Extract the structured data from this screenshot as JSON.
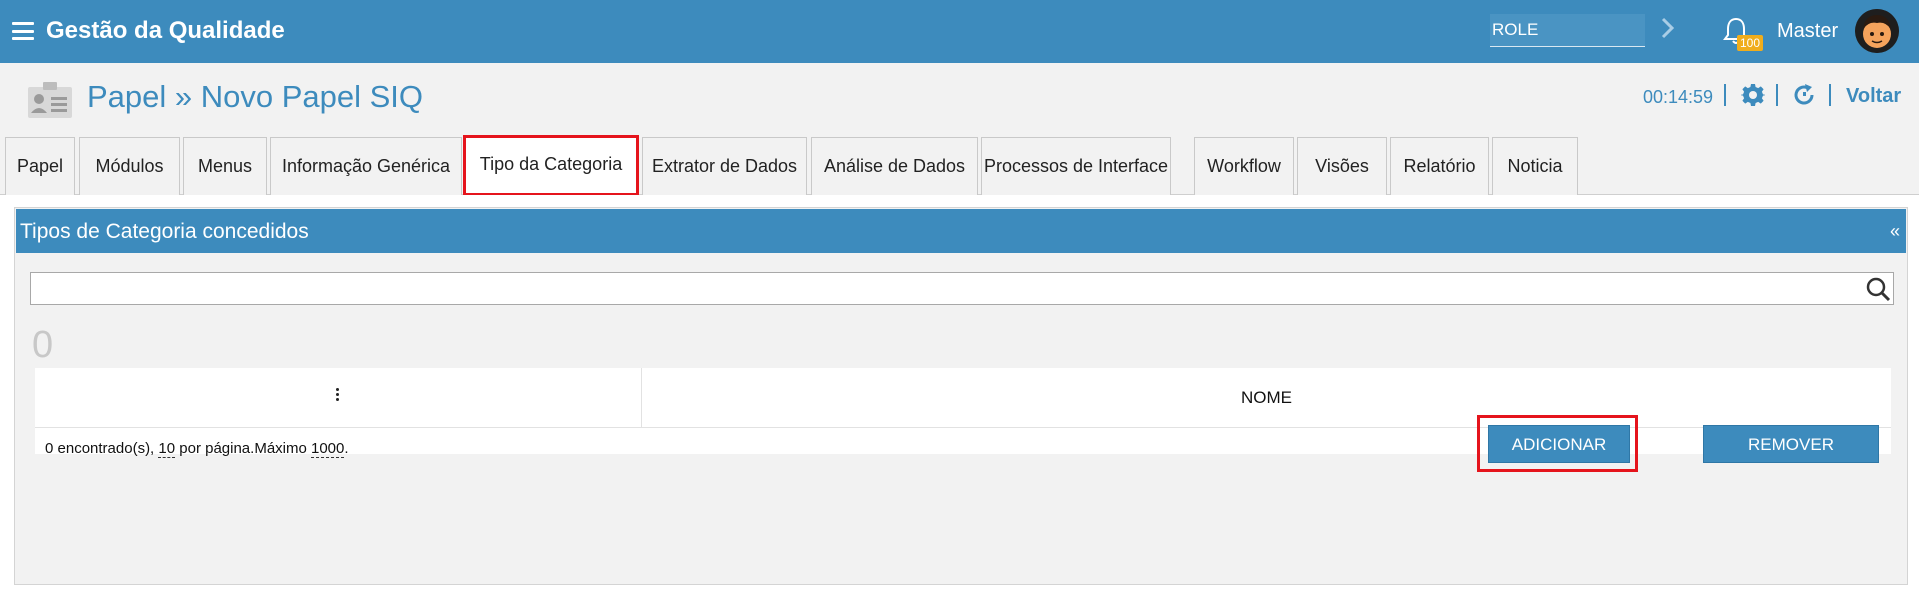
{
  "header": {
    "app_title": "Gestão da Qualidade",
    "role_value": "ROLE",
    "notification_count": "100",
    "user_name": "Master"
  },
  "page": {
    "title": "Papel » Novo Papel SIQ",
    "timer": "00:14:59",
    "back_label": "Voltar"
  },
  "tabs": [
    {
      "label": "Papel"
    },
    {
      "label": "Módulos"
    },
    {
      "label": "Menus"
    },
    {
      "label": "Informação Genérica"
    },
    {
      "label": "Tipo da Categoria",
      "active": true
    },
    {
      "label": "Extrator de Dados"
    },
    {
      "label": "Análise de Dados"
    },
    {
      "label": "Processos de Interface"
    },
    {
      "label": "Workflow"
    },
    {
      "label": "Visões"
    },
    {
      "label": "Relatório"
    },
    {
      "label": "Noticia"
    }
  ],
  "panel": {
    "title": "Tipos de Categoria concedidos",
    "collapse_icon": "«",
    "search_value": "",
    "count": "0",
    "table": {
      "columns": [
        "NOME"
      ]
    },
    "footer": {
      "found_text": "0 encontrado(s), ",
      "per_page": "10",
      "per_page_text": " por página.Máximo ",
      "max": "1000",
      "end": "."
    },
    "add_button": "ADICIONAR",
    "remove_button": "REMOVER"
  },
  "colors": {
    "primary": "#3d8bbd",
    "highlight": "#e5141c",
    "badge": "#f0ad1c"
  }
}
